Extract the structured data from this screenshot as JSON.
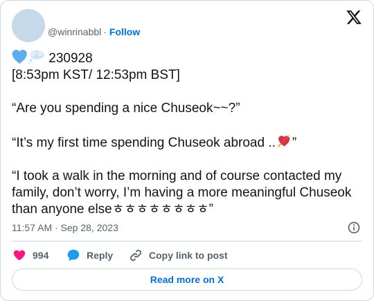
{
  "author": {
    "handle": "@winrinabbl",
    "separator": "·",
    "follow_label": "Follow"
  },
  "logo_icon": "x-logo-icon",
  "tweet": {
    "line1": "230928",
    "line2": "[8:53pm KST/ 12:53pm BST]",
    "line3": "“Are you spending a nice Chuseok~~?”",
    "line4_text": "“It’s my first time spending Chuseok abroad ..",
    "line4_end": "”",
    "line5": "“I took a walk in the morning and of course contacted my family, don’t worry, I’m having a more meaningful Chuseok than anyone elseㅎㅎㅎㅎㅎㅎㅎㅎ”"
  },
  "timestamp": "11:57 AM · Sep 28, 2023",
  "actions": {
    "like_count": "994",
    "reply_label": "Reply",
    "copy_label": "Copy link to post"
  },
  "read_more_label": "Read more on X",
  "colors": {
    "accent": "#006fd6",
    "like": "#f91880",
    "reply": "#1d9bf0",
    "muted": "#536471",
    "border": "#cfd9de"
  }
}
